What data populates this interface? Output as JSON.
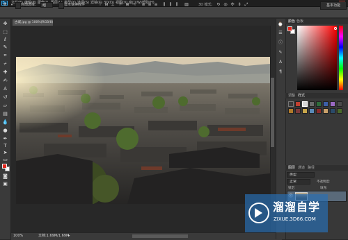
{
  "menubar": {
    "logo": "Ps",
    "items": [
      "文件(F)",
      "编辑(E)",
      "图像(I)",
      "图层(L)",
      "类型(Y)",
      "选择(S)",
      "滤镜(T)",
      "3D(D)",
      "视图(V)",
      "窗口(W)",
      "帮助(H)"
    ],
    "minimize": "—",
    "maximize": "□",
    "close": "×"
  },
  "options": {
    "auto_select_label": "自动选择：",
    "auto_select_value": "组",
    "show_transform_label": "显示变换控件",
    "workspace": "基本功能"
  },
  "document": {
    "tab_title": "古城.jpg @ 100%(RGB/8)",
    "zoom": "100%",
    "doc_info": "文档:1.69M/1.69M"
  },
  "panels": {
    "color_tabs": [
      "颜色",
      "色板"
    ],
    "style_tabs": [
      "调整",
      "样式"
    ],
    "layers_tabs": [
      "图层",
      "通道",
      "路径"
    ],
    "blend_mode": "正常",
    "opacity_label": "不透明度:",
    "lock_label": "锁定:",
    "fill_label": "填充:",
    "filter_label": "类型"
  },
  "colors": {
    "foreground": "#e2261c",
    "background": "#ffffff"
  },
  "watermark": {
    "title": "溜溜自学",
    "url": "ZIXUE.3D66.COM"
  },
  "icons": {
    "tools": [
      "move-icon",
      "marquee-icon",
      "lasso-icon",
      "quick-select-icon",
      "crop-icon",
      "eyedropper-icon",
      "healing-brush-icon",
      "brush-icon",
      "clone-stamp-icon",
      "history-brush-icon",
      "eraser-icon",
      "gradient-icon",
      "blur-icon",
      "dodge-icon",
      "pen-icon",
      "type-icon",
      "path-select-icon",
      "shape-icon",
      "hand-icon",
      "zoom-icon"
    ]
  }
}
